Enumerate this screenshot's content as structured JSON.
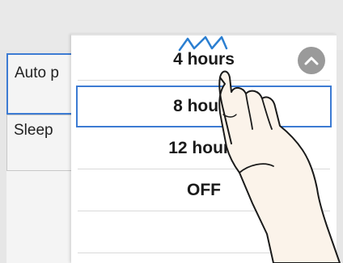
{
  "background_menu": {
    "items": [
      {
        "label": "Auto p"
      },
      {
        "label": "Sleep"
      }
    ]
  },
  "dropdown": {
    "options": [
      {
        "label": "4 hours"
      },
      {
        "label": "8 hours"
      },
      {
        "label": "12 hours"
      },
      {
        "label": "OFF"
      }
    ],
    "selected": "8 hours"
  },
  "icons": {
    "scroll_up": "chevron-up-icon",
    "tap_indicator": "tap-indicator-icon",
    "pointer": "hand-pointer-icon"
  },
  "colors": {
    "selection_border": "#3c7bd3",
    "scroll_button": "#9a9a9a",
    "tap_indicator": "#2b7fd1"
  }
}
